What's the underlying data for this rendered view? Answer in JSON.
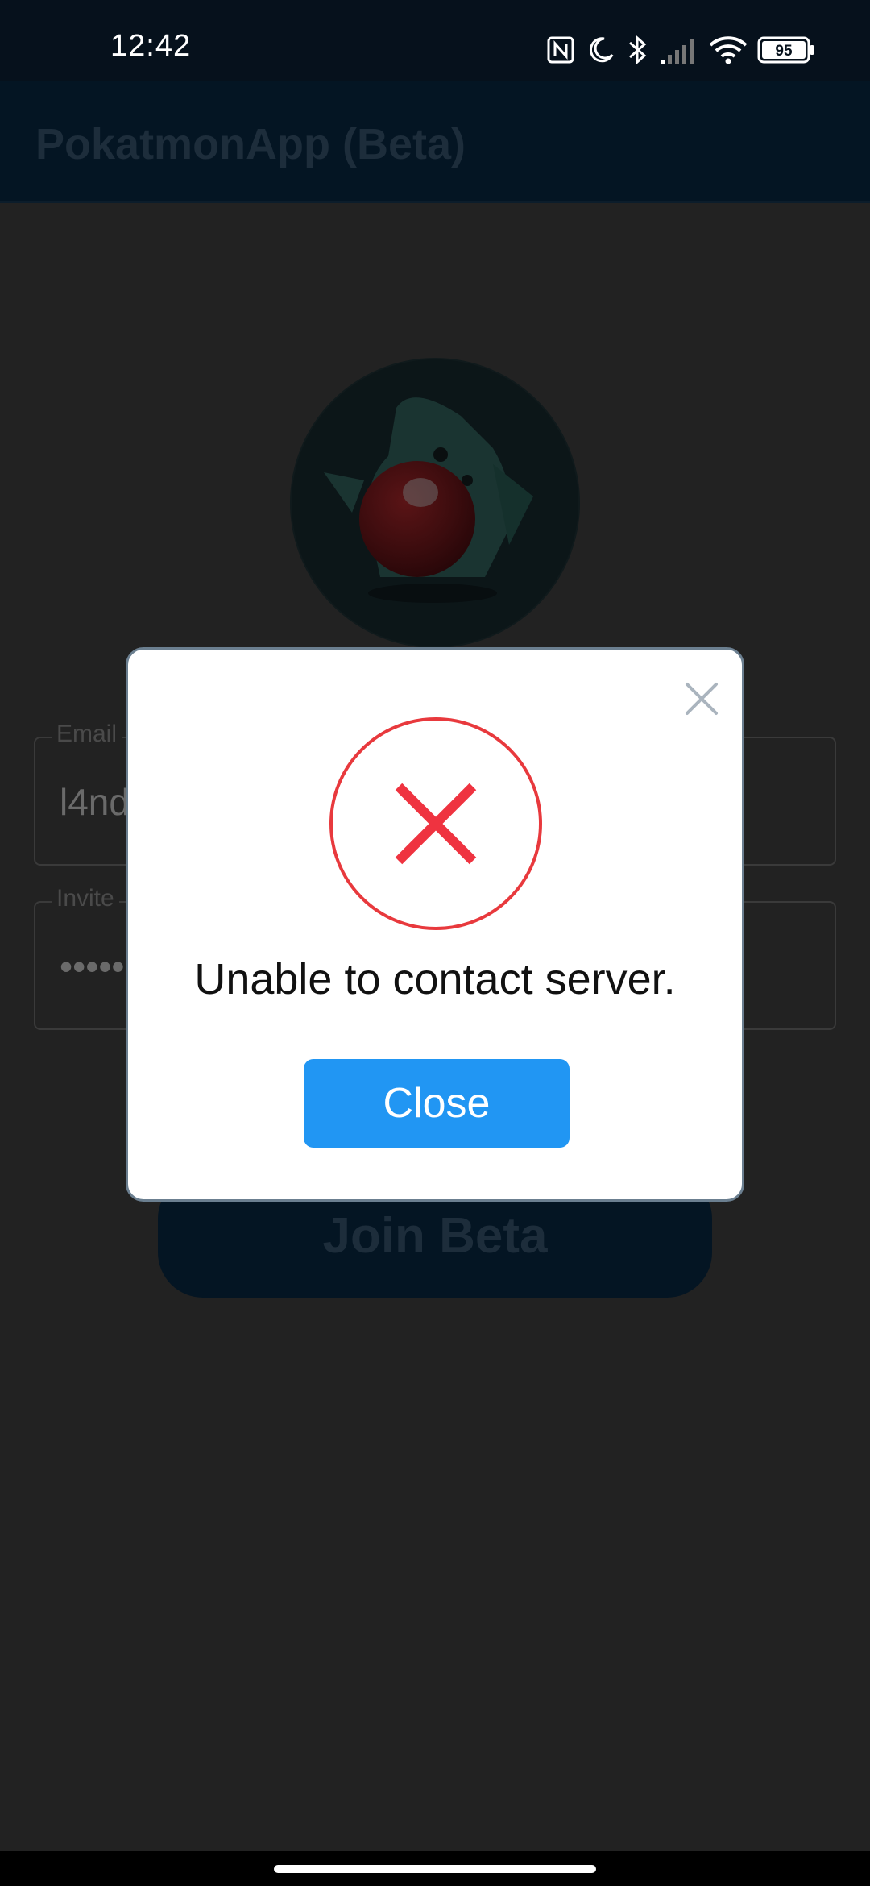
{
  "status_bar": {
    "time": "12:42",
    "battery_level": "95",
    "icons": [
      "nfc-icon",
      "moon-icon",
      "bluetooth-icon",
      "signal-icon",
      "wifi-icon",
      "battery-icon"
    ]
  },
  "app_bar": {
    "title": "PokatmonApp (Beta)"
  },
  "form": {
    "email_label": "Email",
    "email_value": "l4nd",
    "invite_label": "Invite",
    "invite_value": "••••••",
    "join_button": "Join Beta"
  },
  "dialog": {
    "message": "Unable to contact server.",
    "close_button": "Close",
    "icon": "error-x-icon",
    "accent_color": "#e8393d",
    "button_color": "#2196f3"
  }
}
